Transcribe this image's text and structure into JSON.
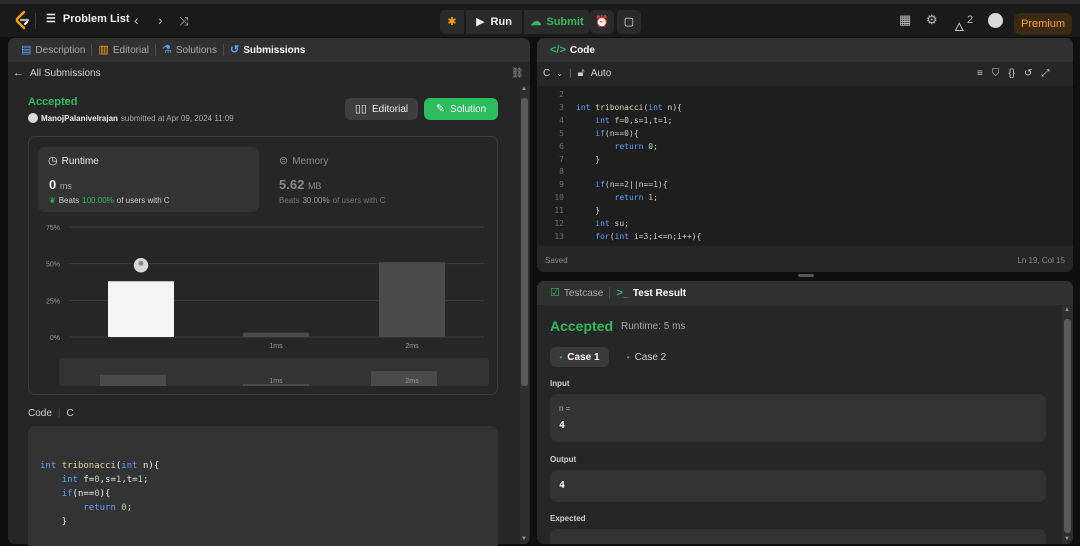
{
  "topbar": {
    "problem_list": "Problem List",
    "run": "Run",
    "submit": "Submit",
    "streak": "2",
    "premium": "Premium"
  },
  "left": {
    "tabs": [
      "Description",
      "Editorial",
      "Solutions",
      "Submissions"
    ],
    "back": "All Submissions",
    "status": "Accepted",
    "user": "ManojPalanivelrajan",
    "submitted_text": "submitted at Apr 09, 2024 11:09",
    "editorial_btn": "Editorial",
    "solution_btn": "Solution",
    "runtime": {
      "label": "Runtime",
      "value": "0",
      "unit": "ms",
      "beats_prefix": "Beats",
      "beats_pct": "100.00%",
      "beats_suffix": "of users with C"
    },
    "memory": {
      "label": "Memory",
      "value": "5.62",
      "unit": "MB",
      "beats_prefix": "Beats",
      "beats_pct": "30.00%",
      "beats_suffix": "of users with C"
    },
    "code_label": "Code",
    "code_lang": "C",
    "code_lines": [
      "int tribonacci(int n){",
      "    int f=0,s=1,t=1;",
      "    if(n==0){",
      "        return 0;",
      "    }"
    ]
  },
  "chart_data": {
    "type": "bar",
    "categories": [
      "0ms",
      "1ms",
      "2ms"
    ],
    "x_tick_labels": [
      "",
      "1ms",
      "2ms"
    ],
    "values": [
      38,
      3,
      51
    ],
    "ylim": [
      0,
      75
    ],
    "y_ticks": [
      "75%",
      "50%",
      "25%",
      "0%"
    ],
    "highlight_index": 0,
    "grid": true
  },
  "editor": {
    "title": "Code",
    "lang": "C",
    "mode": "Auto",
    "saved": "Saved",
    "cursor": "Ln 19, Col 15",
    "line_numbers": [
      "2",
      "3",
      "4",
      "5",
      "6",
      "7",
      "8",
      "9",
      "10",
      "11",
      "12",
      "13"
    ],
    "lines": [
      "",
      "int tribonacci(int n){",
      "    int f=0,s=1,t=1;",
      "    if(n==0){",
      "        return 0;",
      "    }",
      "",
      "    if(n==2||n==1){",
      "        return 1;",
      "    }",
      "    int su;",
      "    for(int i=3;i<=n;i++){"
    ]
  },
  "result": {
    "tabs": [
      "Testcase",
      "Test Result"
    ],
    "status": "Accepted",
    "runtime": "Runtime: 5 ms",
    "cases": [
      "Case 1",
      "Case 2"
    ],
    "input_label": "Input",
    "input_var": "n =",
    "input_value": "4",
    "output_label": "Output",
    "output_value": "4",
    "expected_label": "Expected"
  },
  "colors": {
    "accent_green": "#2cbb5d",
    "premium_orange": "#ffa116",
    "blue_tab": "#5ea1ff"
  }
}
